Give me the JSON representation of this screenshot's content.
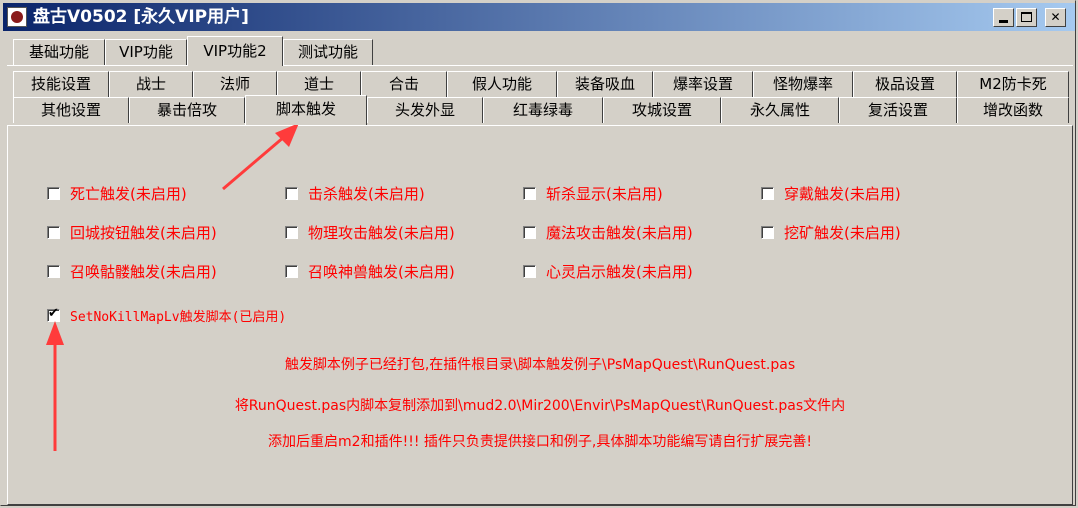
{
  "window": {
    "title": "盘古V0502 [永久VIP用户]"
  },
  "tabs_top": [
    {
      "label": "基础功能"
    },
    {
      "label": "VIP功能"
    },
    {
      "label": "VIP功能2"
    },
    {
      "label": "测试功能"
    }
  ],
  "tabs_row1": [
    {
      "label": "技能设置"
    },
    {
      "label": "战士"
    },
    {
      "label": "法师"
    },
    {
      "label": "道士"
    },
    {
      "label": "合击"
    },
    {
      "label": "假人功能"
    },
    {
      "label": "装备吸血"
    },
    {
      "label": "爆率设置"
    },
    {
      "label": "怪物爆率"
    },
    {
      "label": "极品设置"
    },
    {
      "label": "M2防卡死"
    }
  ],
  "tabs_row2": [
    {
      "label": "其他设置"
    },
    {
      "label": "暴击倍攻"
    },
    {
      "label": "脚本触发"
    },
    {
      "label": "头发外显"
    },
    {
      "label": "红毒绿毒"
    },
    {
      "label": "攻城设置"
    },
    {
      "label": "永久属性"
    },
    {
      "label": "复活设置"
    },
    {
      "label": "增改函数"
    }
  ],
  "checkboxes": [
    {
      "label": "死亡触发(未启用)",
      "checked": false
    },
    {
      "label": "击杀触发(未启用)",
      "checked": false
    },
    {
      "label": "斩杀显示(未启用)",
      "checked": false
    },
    {
      "label": "穿戴触发(未启用)",
      "checked": false
    },
    {
      "label": "回城按钮触发(未启用)",
      "checked": false
    },
    {
      "label": "物理攻击触发(未启用)",
      "checked": false
    },
    {
      "label": "魔法攻击触发(未启用)",
      "checked": false
    },
    {
      "label": "挖矿触发(未启用)",
      "checked": false
    },
    {
      "label": "召唤骷髅触发(未启用)",
      "checked": false
    },
    {
      "label": "召唤神兽触发(未启用)",
      "checked": false
    },
    {
      "label": "心灵启示触发(未启用)",
      "checked": false
    },
    {
      "label": "SetNoKillMapLv触发脚本(已启用)",
      "checked": true
    }
  ],
  "notes": [
    "触发脚本例子已经打包,在插件根目录\\脚本触发例子\\PsMapQuest\\RunQuest.pas",
    "将RunQuest.pas内脚本复制添加到\\mud2.0\\Mir200\\Envir\\PsMapQuest\\RunQuest.pas文件内",
    "添加后重启m2和插件!!! 插件只负责提供接口和例子,具体脚本功能编写请自行扩展完善!"
  ],
  "colors": {
    "label_red": "#ff0000",
    "arrow_red": "#ff3b3b",
    "titlebar": "#0a246a"
  }
}
